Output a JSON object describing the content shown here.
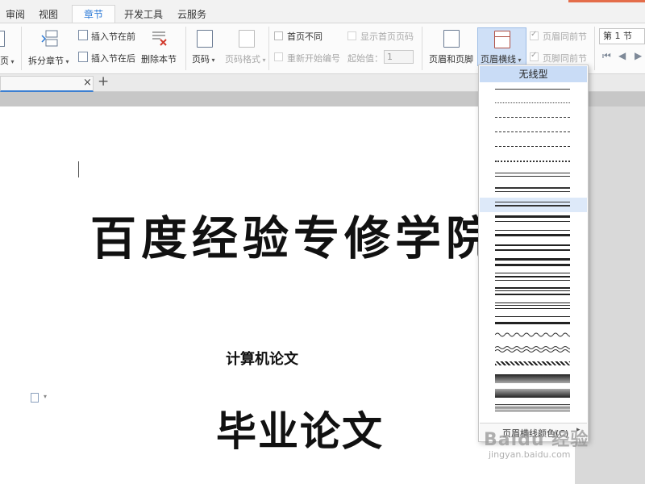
{
  "menu": {
    "tabs": [
      {
        "label": "审阅",
        "active": false
      },
      {
        "label": "视图",
        "active": false
      },
      {
        "label": "章节",
        "active": true
      },
      {
        "label": "开发工具",
        "active": false
      },
      {
        "label": "云服务",
        "active": false
      }
    ]
  },
  "ribbon": {
    "left_cut_label": "页",
    "split_chapter": "拆分章节",
    "insert_before": "插入节在前",
    "insert_after": "插入节在后",
    "delete_section": "删除本节",
    "page_number": "页码",
    "page_format": "页码格式",
    "first_page_diff": "首页不同",
    "show_first_page_num": "显示首页页码",
    "restart_numbering": "重新开始编号",
    "start_value_label": "起始值：",
    "start_value": "1",
    "header_footer": "页眉和页脚",
    "header_line": "页眉横线",
    "header_same_prev": "页眉同前节",
    "footer_same_prev": "页脚同前节",
    "section_value": "第 1 节"
  },
  "tabbar": {
    "close": "×",
    "add": "+"
  },
  "document": {
    "title": "百度经验专修学院",
    "subtitle": "计算机论文",
    "heading": "毕业论文"
  },
  "dropdown": {
    "no_line": "无线型",
    "footer_label": "页眉横线颜色(C)"
  },
  "watermark": {
    "brand": "Baidu 经验",
    "url": "jingyan.baidu.com"
  },
  "colors": {
    "accent_tab": "#2b79d6",
    "selection": "#c9dcf6",
    "corner_accent": "#e46d4a"
  }
}
